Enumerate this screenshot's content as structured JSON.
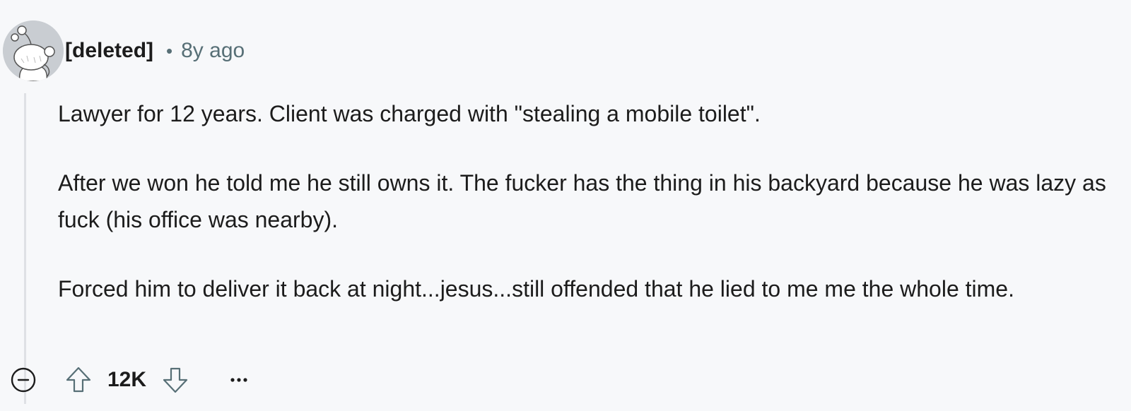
{
  "comment": {
    "author": "[deleted]",
    "separator": "•",
    "time_ago": "8y ago",
    "paragraphs": [
      "Lawyer for 12 years. Client was charged with \"stealing a mobile toilet\".",
      "After we won he told me he still owns it. The fucker has the thing in his backyard because he was lazy as fuck (his office was nearby).",
      "Forced him to deliver it back at night...jesus...still offended that he lied to me me the whole time."
    ]
  },
  "actions": {
    "score": "12K",
    "collapse_icon": "minus-circle-icon",
    "upvote_icon": "arrow-up-outline-icon",
    "downvote_icon": "arrow-down-outline-icon",
    "more_icon": "ellipsis-icon"
  },
  "colors": {
    "background": "#f7f8fa",
    "text": "#1c1c1c",
    "meta": "#576f76",
    "thread_line": "#dfe1e5"
  }
}
